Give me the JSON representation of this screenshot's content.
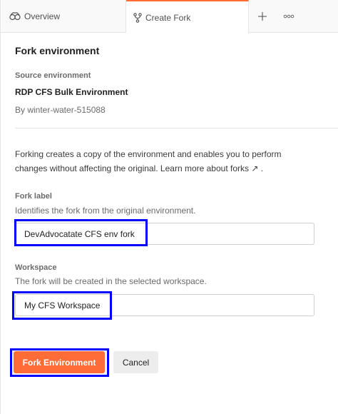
{
  "tabs": {
    "overview": {
      "label": "Overview",
      "icon": "environment-overview-icon"
    },
    "create_fork": {
      "label": "Create Fork",
      "icon": "fork-icon",
      "active": true
    },
    "add_icon": "plus-icon",
    "more_icon": "more-options-icon"
  },
  "page": {
    "title": "Fork environment",
    "source_label": "Source environment",
    "source_name": "RDP CFS Bulk Environment",
    "source_author": "By winter-water-515088",
    "description": "Forking creates a copy of the environment and enables you to perform changes without affecting the original.",
    "learn_more": "Learn more about forks ↗",
    "description_end": "."
  },
  "fork_label": {
    "label": "Fork label",
    "help": "Identifies the fork from the original environment.",
    "value": "DevAdvocatate CFS env fork"
  },
  "workspace": {
    "label": "Workspace",
    "help": "The fork will be created in the selected workspace.",
    "value": "My CFS Workspace"
  },
  "actions": {
    "fork_button": "Fork Environment",
    "cancel_button": "Cancel"
  },
  "colors": {
    "accent": "#ff6c37",
    "highlight": "#0000ff"
  }
}
